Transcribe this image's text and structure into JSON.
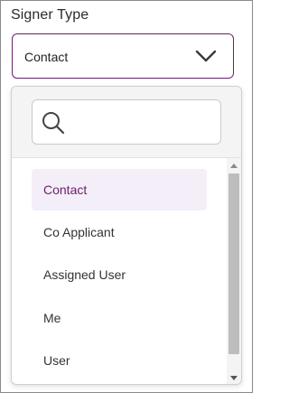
{
  "field": {
    "label": "Signer Type",
    "selected_value": "Contact"
  },
  "search": {
    "value": "",
    "placeholder": ""
  },
  "options": [
    {
      "label": "Contact",
      "selected": true
    },
    {
      "label": "Co Applicant",
      "selected": false
    },
    {
      "label": "Assigned User",
      "selected": false
    },
    {
      "label": "Me",
      "selected": false
    },
    {
      "label": "User",
      "selected": false
    }
  ],
  "colors": {
    "accent": "#6b1f6b",
    "selected_bg": "#f3eef7",
    "border": "#c9c9c9"
  },
  "icons": {
    "select_toggle": "chevron-down-icon",
    "search": "search-icon"
  }
}
